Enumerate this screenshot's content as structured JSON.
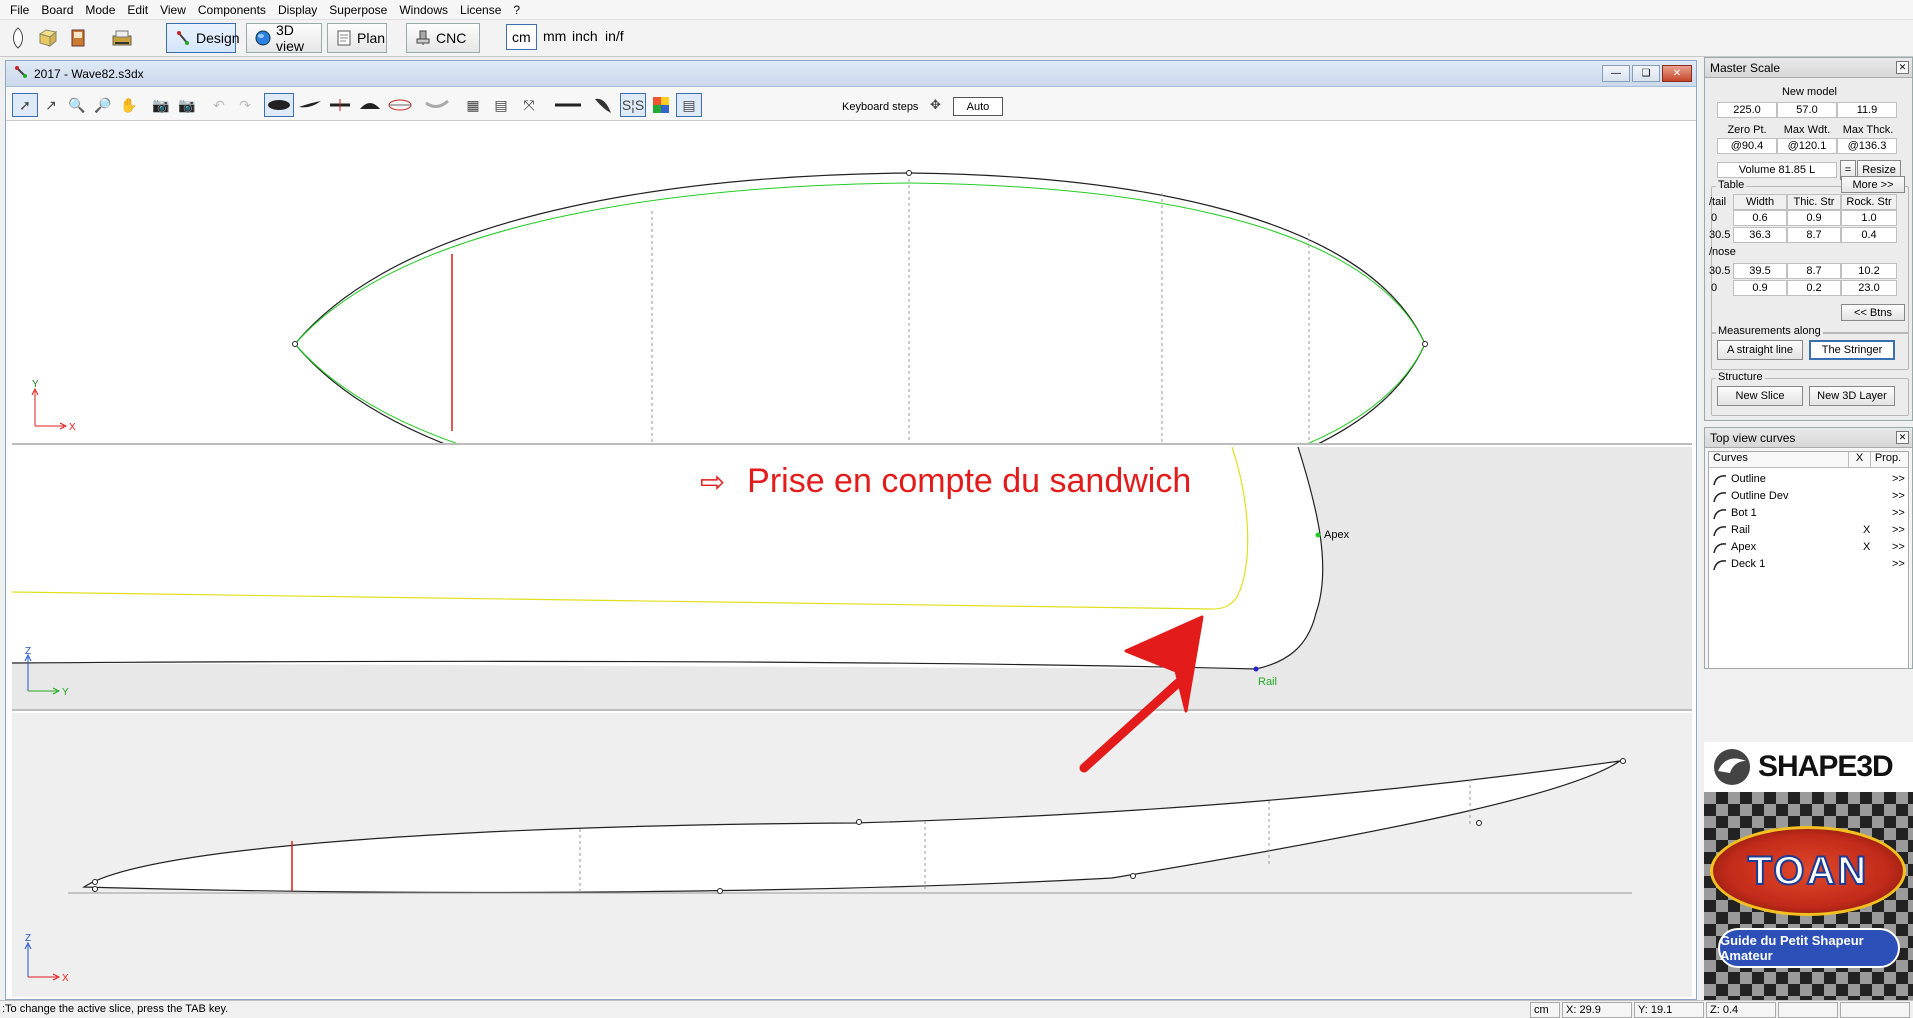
{
  "menu": [
    "File",
    "Board",
    "Mode",
    "Edit",
    "View",
    "Components",
    "Display",
    "Superpose",
    "Windows",
    "License",
    "?"
  ],
  "modes": {
    "design": "Design",
    "view3d": "3D view",
    "plan": "Plan",
    "cnc": "CNC"
  },
  "units": [
    "cm",
    "mm",
    "inch",
    "in/f"
  ],
  "doc": {
    "title": "2017 - Wave82.s3dx",
    "keyboard_steps": "Keyboard steps",
    "auto": "Auto"
  },
  "views": {
    "top": {
      "axis_y": "Y",
      "axis_x": "X"
    },
    "slice": {
      "axis_z": "Z",
      "axis_y": "Y",
      "apex": "Apex",
      "rail": "Rail"
    },
    "side": {
      "axis_z": "Z",
      "axis_x": "X"
    }
  },
  "annotation": {
    "arrow": "⇨",
    "text": "Prise en compte du sandwich"
  },
  "master_scale": {
    "title": "Master Scale",
    "model_name": "New model",
    "dims": [
      "225.0",
      "57.0",
      "11.9"
    ],
    "headers": [
      "Zero Pt.",
      "Max Wdt.",
      "Max Thck."
    ],
    "positions": [
      "@90.4",
      "@120.1",
      "@136.3"
    ],
    "volume": "Volume 81.85 L",
    "eq": "=",
    "resize": "Resize",
    "table_label": "Table",
    "more": "More >>",
    "tail_label": "/tail",
    "cols": [
      "Width",
      "Thic. Str",
      "Rock. Str"
    ],
    "tail_rows": [
      {
        "pos": "0",
        "vals": [
          "0.6",
          "0.9",
          "1.0"
        ]
      },
      {
        "pos": "30.5",
        "vals": [
          "36.3",
          "8.7",
          "0.4"
        ]
      }
    ],
    "nose_label": "/nose",
    "nose_rows": [
      {
        "pos": "30.5",
        "vals": [
          "39.5",
          "8.7",
          "10.2"
        ]
      },
      {
        "pos": "0",
        "vals": [
          "0.9",
          "0.2",
          "23.0"
        ]
      }
    ],
    "btns": "<< Btns",
    "measure_label": "Measurements along",
    "straight": "A straight line",
    "stringer": "The Stringer",
    "structure_label": "Structure",
    "new_slice": "New Slice",
    "new_layer": "New 3D Layer"
  },
  "curves_panel": {
    "title": "Top view curves",
    "headers": [
      "Curves",
      "X",
      "Prop."
    ],
    "rows": [
      {
        "name": "Outline",
        "x": "",
        "prop": ">>"
      },
      {
        "name": "Outline Dev",
        "x": "",
        "prop": ">>"
      },
      {
        "name": "Bot 1",
        "x": "",
        "prop": ">>"
      },
      {
        "name": "Rail",
        "x": "X",
        "prop": ">>"
      },
      {
        "name": "Apex",
        "x": "X",
        "prop": ">>"
      },
      {
        "name": "Deck 1",
        "x": "",
        "prop": ">>"
      }
    ]
  },
  "brand": {
    "shape3d": "SHAPE3D",
    "toan": "TOAN",
    "guide": "Guide du Petit Shapeur Amateur"
  },
  "status": {
    "message": ":To change the active slice, press the TAB key.",
    "unit": "cm",
    "x": "X: 29.9",
    "y": "Y: 19.1",
    "z": "Z: 0.4"
  },
  "colors": {
    "accent": "#3a6fb0",
    "annotation": "#e31b1b",
    "outline_dev": "#22cc22",
    "sandwich": "#e0e020"
  }
}
